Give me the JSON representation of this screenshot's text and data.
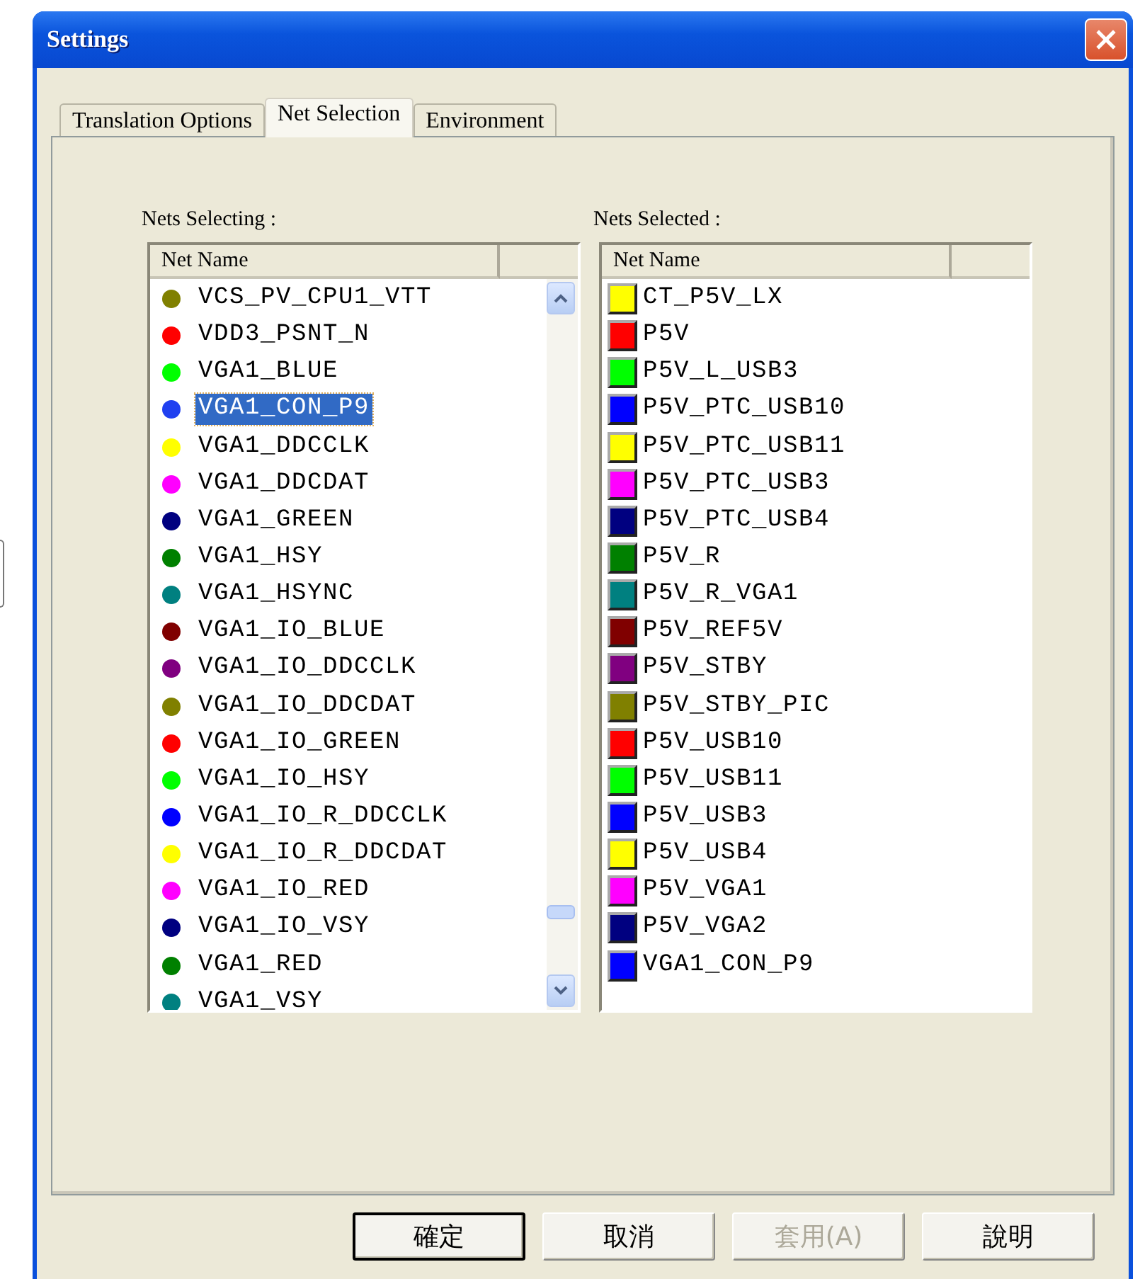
{
  "window": {
    "title": "Settings"
  },
  "tabs": [
    {
      "label": "Translation Options",
      "selected": false
    },
    {
      "label": "Net Selection",
      "selected": true
    },
    {
      "label": "Environment",
      "selected": false
    }
  ],
  "nets_selecting": {
    "label": "Nets Selecting :",
    "column": "Net Name",
    "items": [
      {
        "name": "VCS_PV_CPU1_VTT",
        "color": "#808000",
        "selected": false
      },
      {
        "name": "VDD3_PSNT_N",
        "color": "#ff0000",
        "selected": false
      },
      {
        "name": "VGA1_BLUE",
        "color": "#00ff00",
        "selected": false
      },
      {
        "name": "VGA1_CON_P9",
        "color": "#2040f0",
        "selected": true
      },
      {
        "name": "VGA1_DDCCLK",
        "color": "#ffff00",
        "selected": false
      },
      {
        "name": "VGA1_DDCDAT",
        "color": "#ff00ff",
        "selected": false
      },
      {
        "name": "VGA1_GREEN",
        "color": "#000080",
        "selected": false
      },
      {
        "name": "VGA1_HSY",
        "color": "#008000",
        "selected": false
      },
      {
        "name": "VGA1_HSYNC",
        "color": "#008080",
        "selected": false
      },
      {
        "name": "VGA1_IO_BLUE",
        "color": "#800000",
        "selected": false
      },
      {
        "name": "VGA1_IO_DDCCLK",
        "color": "#800080",
        "selected": false
      },
      {
        "name": "VGA1_IO_DDCDAT",
        "color": "#808000",
        "selected": false
      },
      {
        "name": "VGA1_IO_GREEN",
        "color": "#ff0000",
        "selected": false
      },
      {
        "name": "VGA1_IO_HSY",
        "color": "#00ff00",
        "selected": false
      },
      {
        "name": "VGA1_IO_R_DDCCLK",
        "color": "#0000ff",
        "selected": false
      },
      {
        "name": "VGA1_IO_R_DDCDAT",
        "color": "#ffff00",
        "selected": false
      },
      {
        "name": "VGA1_IO_RED",
        "color": "#ff00ff",
        "selected": false
      },
      {
        "name": "VGA1_IO_VSY",
        "color": "#000080",
        "selected": false
      },
      {
        "name": "VGA1_RED",
        "color": "#008000",
        "selected": false
      },
      {
        "name": "VGA1_VSY",
        "color": "#008080",
        "selected": false
      }
    ]
  },
  "nets_selected": {
    "label": "Nets Selected :",
    "column": "Net Name",
    "items": [
      {
        "name": "CT_P5V_LX",
        "color": "#ffff00"
      },
      {
        "name": "P5V",
        "color": "#ff0000"
      },
      {
        "name": "P5V_L_USB3",
        "color": "#00ff00"
      },
      {
        "name": "P5V_PTC_USB10",
        "color": "#0000ff"
      },
      {
        "name": "P5V_PTC_USB11",
        "color": "#ffff00"
      },
      {
        "name": "P5V_PTC_USB3",
        "color": "#ff00ff"
      },
      {
        "name": "P5V_PTC_USB4",
        "color": "#000080"
      },
      {
        "name": "P5V_R",
        "color": "#008000"
      },
      {
        "name": "P5V_R_VGA1",
        "color": "#008080"
      },
      {
        "name": "P5V_REF5V",
        "color": "#800000"
      },
      {
        "name": "P5V_STBY",
        "color": "#800080"
      },
      {
        "name": "P5V_STBY_PIC",
        "color": "#808000"
      },
      {
        "name": "P5V_USB10",
        "color": "#ff0000"
      },
      {
        "name": "P5V_USB11",
        "color": "#00ff00"
      },
      {
        "name": "P5V_USB3",
        "color": "#0000ff"
      },
      {
        "name": "P5V_USB4",
        "color": "#ffff00"
      },
      {
        "name": "P5V_VGA1",
        "color": "#ff00ff"
      },
      {
        "name": "P5V_VGA2",
        "color": "#000080"
      },
      {
        "name": "VGA1_CON_P9",
        "color": "#0000ff"
      }
    ]
  },
  "buttons": [
    {
      "label": "確定",
      "kind": "default",
      "disabled": false
    },
    {
      "label": "取消",
      "kind": "normal",
      "disabled": false
    },
    {
      "label": "套用(A)",
      "kind": "normal",
      "disabled": true
    },
    {
      "label": "說明",
      "kind": "normal",
      "disabled": false
    }
  ]
}
